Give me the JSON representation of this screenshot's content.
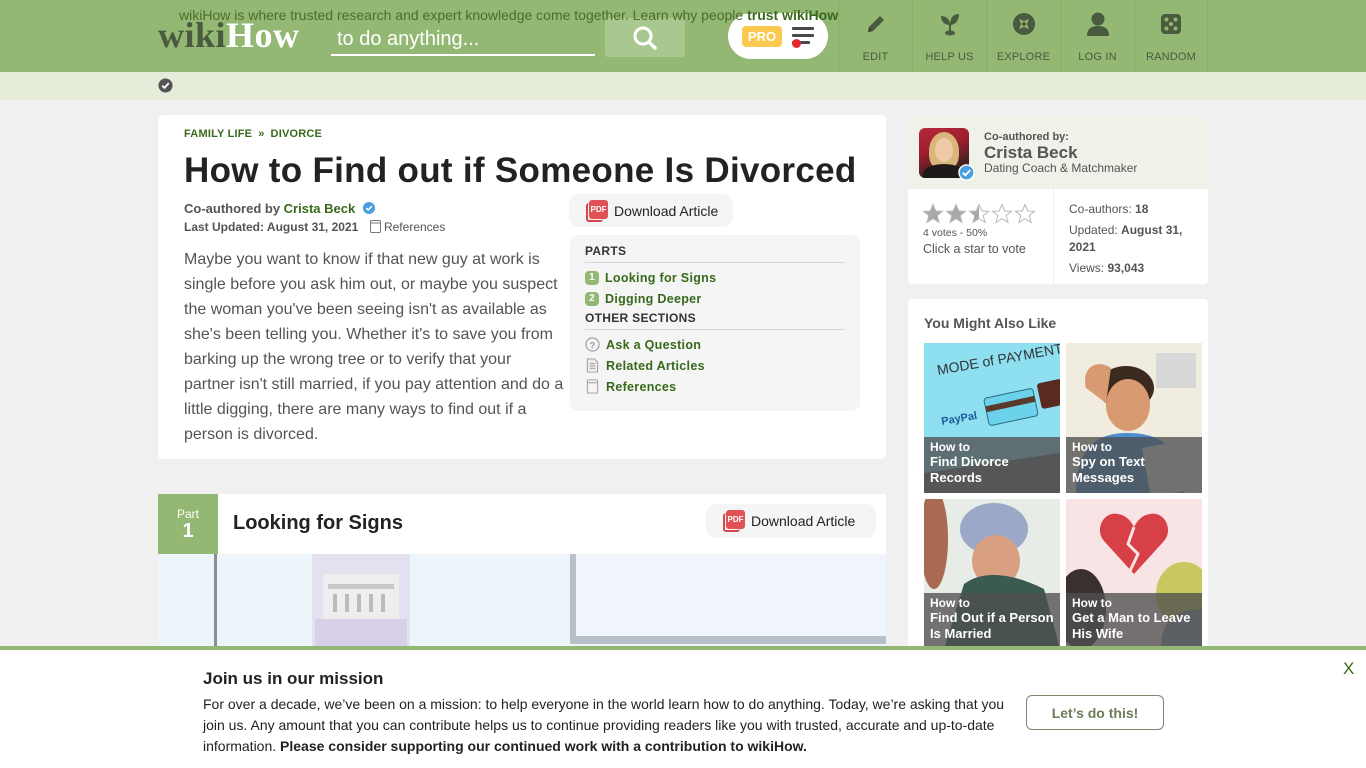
{
  "header": {
    "logo_wiki": "wiki",
    "logo_how": "How",
    "search_placeholder": "to do anything...",
    "pro_badge": "PRO",
    "nav": [
      {
        "label": "EDIT",
        "icon": "pencil-icon"
      },
      {
        "label": "HELP US",
        "icon": "sprout-icon"
      },
      {
        "label": "EXPLORE",
        "icon": "compass-icon"
      },
      {
        "label": "LOG IN",
        "icon": "user-icon"
      },
      {
        "label": "RANDOM",
        "icon": "dice-icon"
      }
    ],
    "colors": {
      "brand": "#93b874",
      "dark_text": "#4a5a3e"
    }
  },
  "trust_bar": {
    "text": "wikiHow is where trusted research and expert knowledge come together. Learn why people ",
    "link": "trust wikiHow"
  },
  "article": {
    "breadcrumb": [
      "FAMILY LIFE",
      "DIVORCE"
    ],
    "breadcrumb_sep": "»",
    "title": "How to Find out if Someone Is Divorced",
    "coauthored_prefix": "Co-authored by ",
    "author": "Crista Beck",
    "updated_label": "Last Updated: ",
    "updated_date": "August 31, 2021",
    "references_label": "References",
    "download_label": "Download Article",
    "pdf_label": "PDF",
    "intro": "Maybe you want to know if that new guy at work is single before you ask him out, or maybe you suspect the woman you've been seeing isn't as available as she's been telling you. Whether it's to save you from barking up the wrong tree or to verify that your partner isn't still married, if you pay attention and do a little digging, there are many ways to find out if a person is divorced.",
    "toc": {
      "parts_heading": "PARTS",
      "parts": [
        {
          "num": "1",
          "label": "Looking for Signs"
        },
        {
          "num": "2",
          "label": "Digging Deeper"
        }
      ],
      "other_heading": "OTHER SECTIONS",
      "other": [
        {
          "label": "Ask a Question",
          "icon": "question-circle-icon"
        },
        {
          "label": "Related Articles",
          "icon": "document-icon"
        },
        {
          "label": "References",
          "icon": "bookmark-icon"
        }
      ]
    }
  },
  "part": {
    "label": "Part",
    "number": "1",
    "title": "Looking for Signs",
    "download_label": "Download Article"
  },
  "sidebar": {
    "author_card": {
      "coauthored_label": "Co-authored by:",
      "name": "Crista Beck",
      "role": "Dating Coach & Matchmaker",
      "rating": 2.5,
      "rating_max": 5,
      "votes_text": "4 votes - 50%",
      "vote_cta": "Click a star to vote",
      "coauthors_label": "Co-authors: ",
      "coauthors": "18",
      "updated_label": "Updated: ",
      "updated": "August 31, 2021",
      "views_label": "Views: ",
      "views": "93,043"
    },
    "related": {
      "heading": "You Might Also Like",
      "items": [
        {
          "how": "How to",
          "title": "Find Divorce Records"
        },
        {
          "how": "How to",
          "title": "Spy on Text Messages"
        },
        {
          "how": "How to",
          "title": "Find Out if a Person Is Married"
        },
        {
          "how": "How to",
          "title": "Get a Man to Leave His Wife"
        }
      ]
    }
  },
  "mission": {
    "title": "Join us in our mission",
    "text": "For over a decade, we’ve been on a mission: to help everyone in the world learn how to do anything. Today, we’re asking that you join us. Any amount that you can contribute helps us to continue providing readers like you with trusted, accurate and up-to-date information. ",
    "text_bold": "Please consider supporting our continued work with a contribution to wikiHow.",
    "cta": "Let’s do this!",
    "close": "X"
  }
}
